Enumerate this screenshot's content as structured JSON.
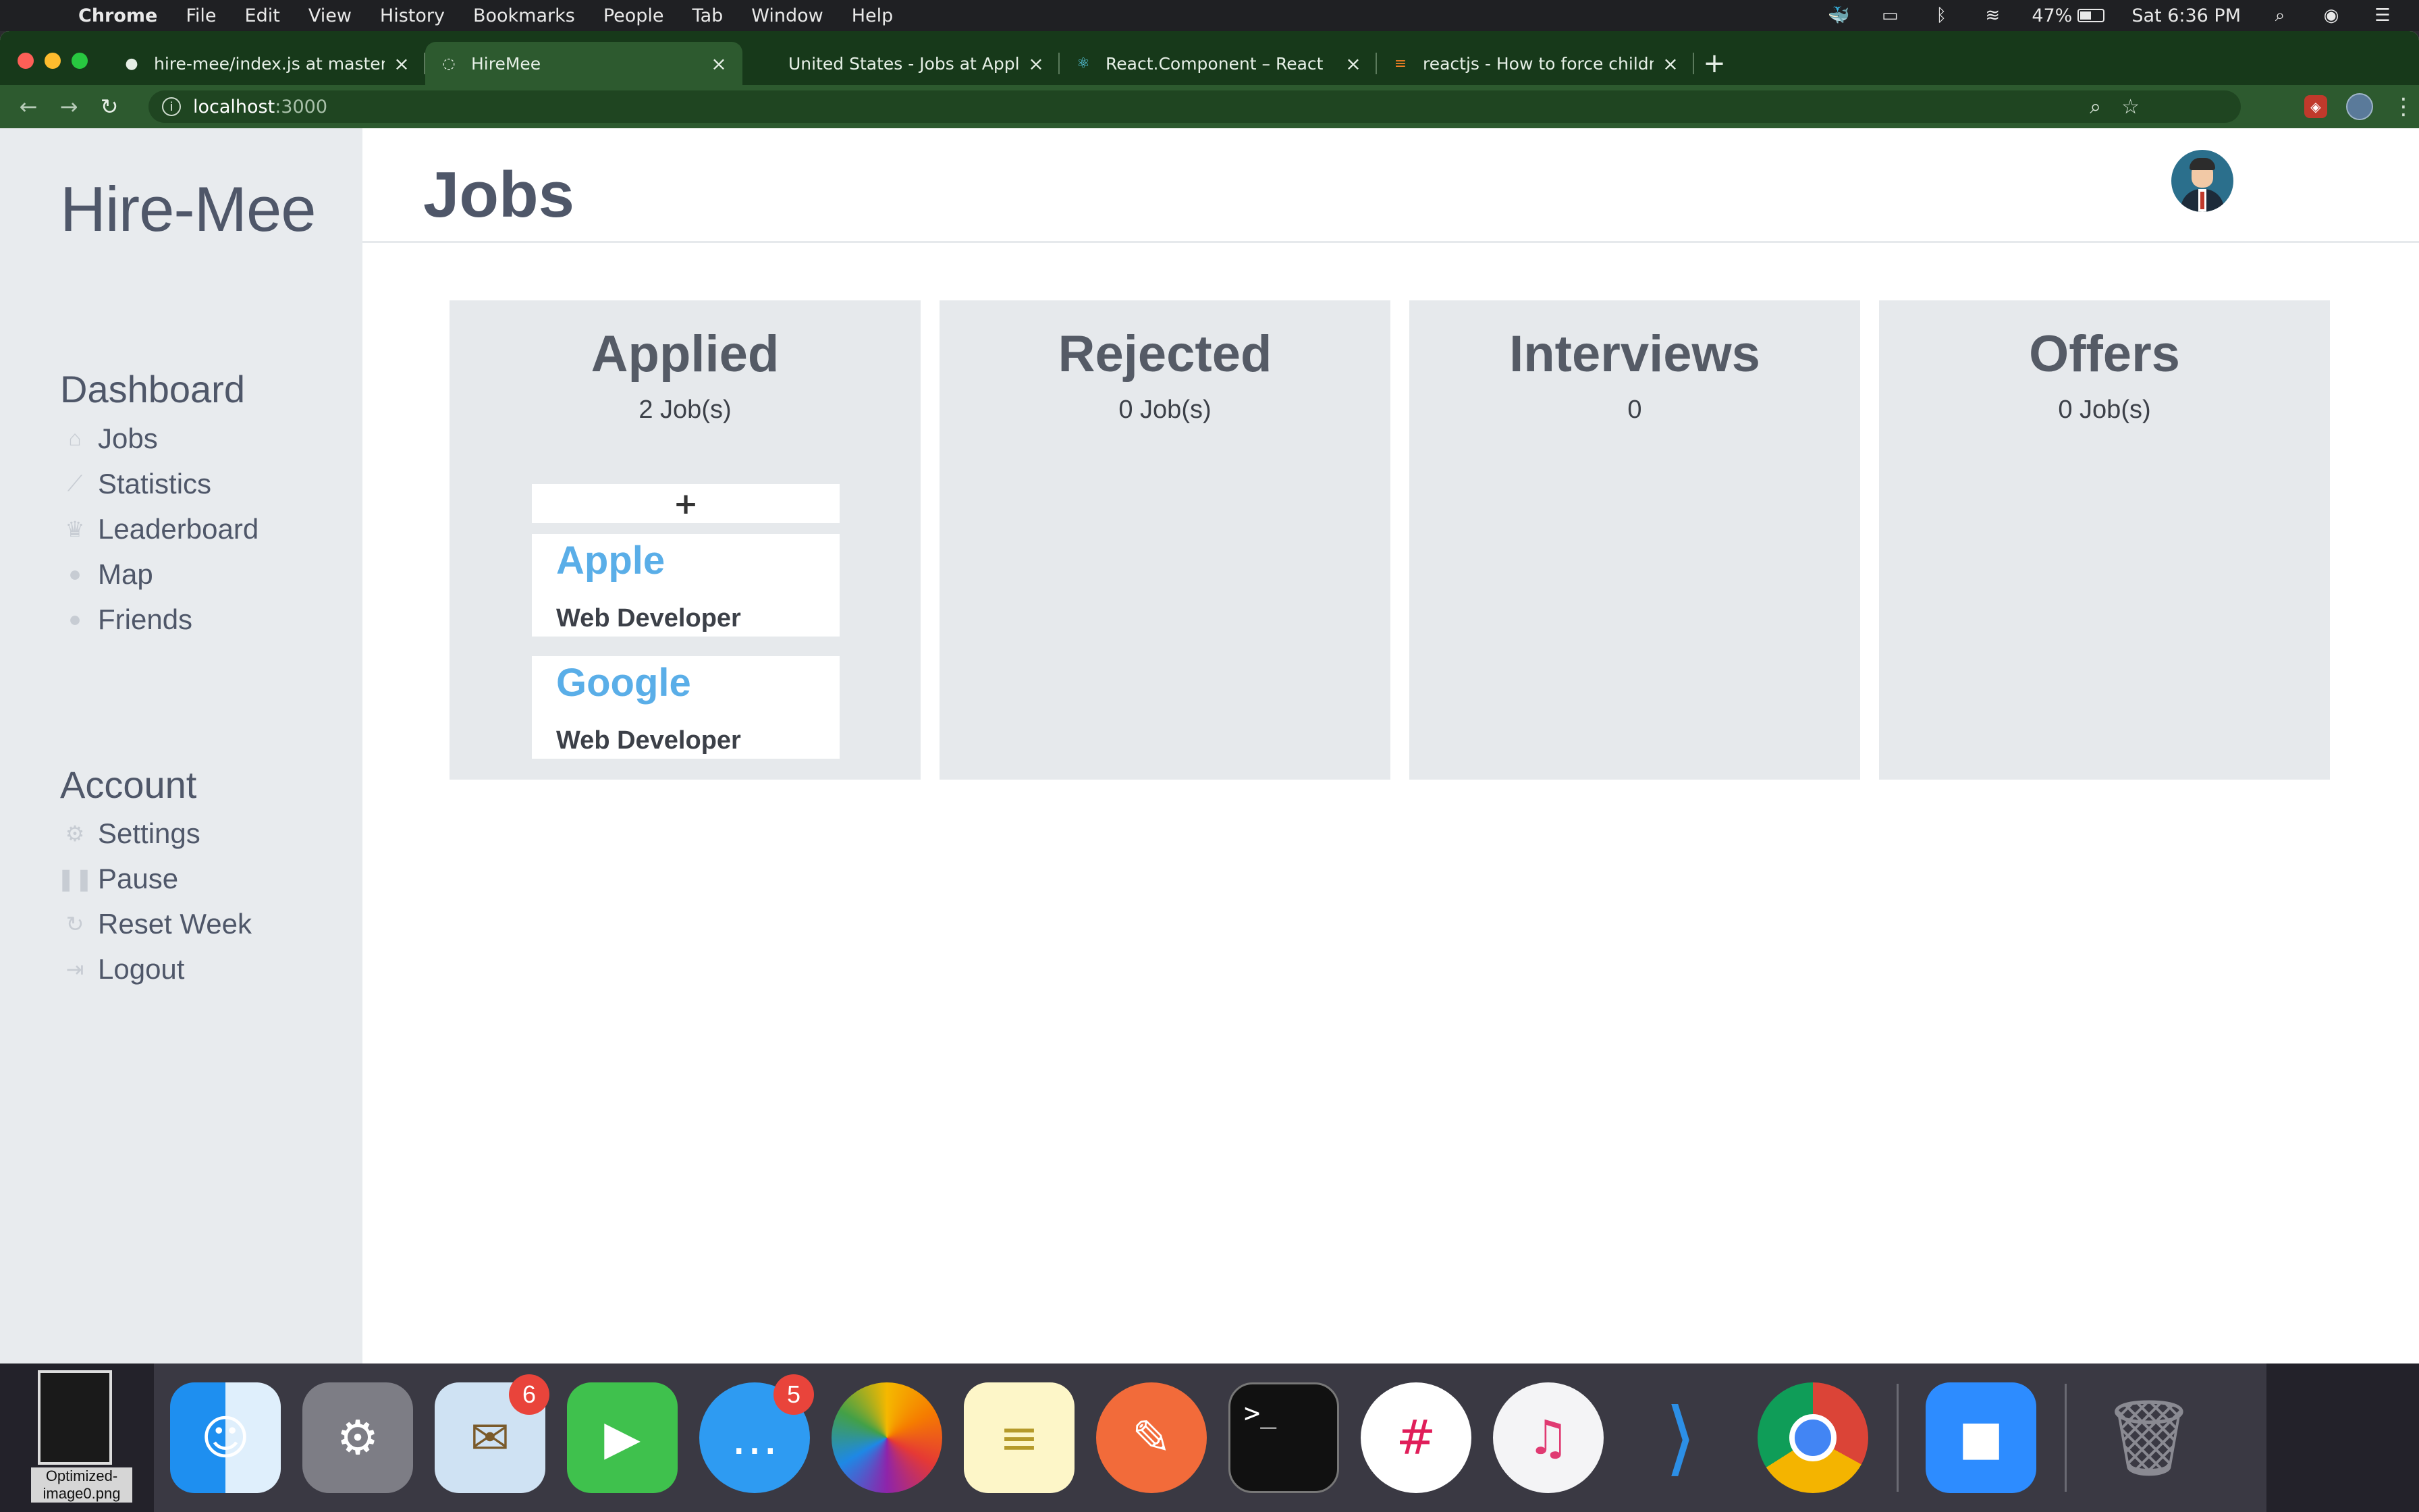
{
  "menubar": {
    "app": "Chrome",
    "items": [
      "File",
      "Edit",
      "View",
      "History",
      "Bookmarks",
      "People",
      "Tab",
      "Window",
      "Help"
    ],
    "battery": "47%",
    "clock": "Sat 6:36 PM"
  },
  "browser": {
    "tabs": [
      {
        "title": "hire-mee/index.js at master · h",
        "icon": "github-icon",
        "active": false
      },
      {
        "title": "HireMee",
        "icon": "globe-icon",
        "active": true
      },
      {
        "title": "United States - Jobs at Apple",
        "icon": "apple-icon",
        "active": false
      },
      {
        "title": "React.Component – React",
        "icon": "react-icon",
        "active": false
      },
      {
        "title": "reactjs - How to force children",
        "icon": "stackoverflow-icon",
        "active": false
      }
    ],
    "url_host": "localhost",
    "url_port": ":3000"
  },
  "app": {
    "brand": "Hire-Mee",
    "page_title": "Jobs",
    "dashboard": {
      "title": "Dashboard",
      "items": [
        {
          "label": "Jobs",
          "icon": "briefcase-icon"
        },
        {
          "label": "Statistics",
          "icon": "chart-icon"
        },
        {
          "label": "Leaderboard",
          "icon": "trophy-icon"
        },
        {
          "label": "Map",
          "icon": "map-pin-icon"
        },
        {
          "label": "Friends",
          "icon": "user-icon"
        }
      ]
    },
    "account": {
      "title": "Account",
      "items": [
        {
          "label": "Settings",
          "icon": "gear-icon"
        },
        {
          "label": "Pause",
          "icon": "pause-icon"
        },
        {
          "label": "Reset Week",
          "icon": "refresh-icon"
        },
        {
          "label": "Logout",
          "icon": "logout-icon"
        }
      ]
    },
    "columns": [
      {
        "title": "Applied",
        "count": "2 Job(s)"
      },
      {
        "title": "Rejected",
        "count": "0 Job(s)"
      },
      {
        "title": "Interviews",
        "count": "0"
      },
      {
        "title": "Offers",
        "count": "0 Job(s)"
      }
    ],
    "add_label": "+",
    "jobs": [
      {
        "company": "Apple",
        "role": "Web Developer"
      },
      {
        "company": "Google",
        "role": "Web Developer"
      }
    ],
    "colors": {
      "accent": "#5aaee8",
      "sidebar": "#e8ebee",
      "text": "#4f5769"
    }
  },
  "dock": {
    "desktop_file": "Optimized-image0.png",
    "apps": [
      {
        "name": "finder-icon"
      },
      {
        "name": "system-preferences-icon"
      },
      {
        "name": "mail-icon",
        "badge": "6"
      },
      {
        "name": "facetime-icon"
      },
      {
        "name": "messages-icon",
        "badge": "5"
      },
      {
        "name": "photos-icon"
      },
      {
        "name": "notes-icon"
      },
      {
        "name": "postman-icon"
      },
      {
        "name": "terminal-icon"
      },
      {
        "name": "slack-icon"
      },
      {
        "name": "music-icon"
      },
      {
        "name": "vscode-icon"
      },
      {
        "name": "chrome-icon"
      },
      {
        "name": "zoom-icon"
      },
      {
        "name": "trash-icon"
      }
    ]
  }
}
